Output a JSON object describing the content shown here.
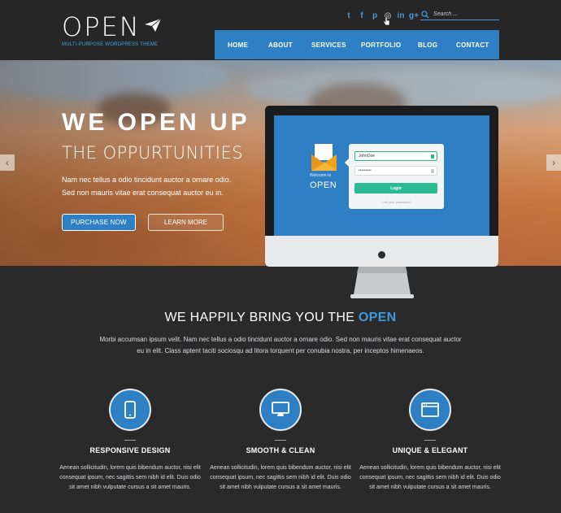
{
  "header": {
    "logo": "OPEN",
    "tagline": "MULTI-PURPOSE WORDPRESS THEME",
    "social": [
      {
        "icon": "twitter-icon",
        "glyph": "t"
      },
      {
        "icon": "facebook-icon",
        "glyph": "f"
      },
      {
        "icon": "pinterest-icon",
        "glyph": "p"
      },
      {
        "icon": "dribbble-icon",
        "glyph": "◎"
      },
      {
        "icon": "linkedin-icon",
        "glyph": "in"
      },
      {
        "icon": "google-plus-icon",
        "glyph": "g+"
      }
    ],
    "search_placeholder": "Search ...",
    "nav": [
      "HOME",
      "ABOUT",
      "SERVICES",
      "PORTFOLIO",
      "BLOG",
      "CONTACT"
    ]
  },
  "hero": {
    "title": "WE OPEN UP",
    "subtitle": "THE OPPURTUNITIES",
    "line1": "Nam nec tellus a odio tincidunt auctor a ornare odio.",
    "line2": "Sed non  mauris vitae erat consequat auctor eu in.",
    "purchase_label": "PURCHASE NOW",
    "learn_label": "LEARN MORE",
    "prev": "‹",
    "next": "›"
  },
  "screen": {
    "welcome": "Welcome to",
    "brand": "OPEN",
    "username": "JohnDoe",
    "password": "•••••••••",
    "login_label": "Login",
    "lost_password": "Lost your password?"
  },
  "intro": {
    "title_prefix": "WE HAPPILY BRING YOU THE",
    "title_highlight": "OPEN",
    "line1": "Morbi accumsan ipsum velit. Nam nec tellus a odio tincidunt auctor a ornare odio. Sed non  mauris vitae erat consequat auctor",
    "line2": "eu in elit. Class aptent taciti sociosqu ad litora torquent per conubia nostra, per inceptos himenaeos."
  },
  "features": [
    {
      "icon": "smartphone-icon",
      "title": "RESPONSIVE DESIGN",
      "lines": [
        "Aenean sollicitudin, lorem quis bibendum auctor, nisi elit",
        "consequat ipsum, nec sagittis sem nibh id elit. Duis odio",
        "sit amet nibh vulputate cursus a sit amet mauris."
      ]
    },
    {
      "icon": "monitor-icon",
      "title": "SMOOTH & CLEAN",
      "lines": [
        "Aenean sollicitudin, lorem quis bibendum auctor, nisi elit",
        "consequat ipsum, nec sagittis sem nibh id elit. Duis odio",
        "sit amet nibh vulputate cursus a sit amet mauris."
      ]
    },
    {
      "icon": "browser-window-icon",
      "title": "UNIQUE & ELEGANT",
      "lines": [
        "Aenean sollicitudin, lorem quis bibendum auctor, nisi elit",
        "consequat ipsum, nec sagittis sem nibh id elit. Duis odio",
        "sit amet nibh vulputate cursus a sit amet mauris."
      ]
    }
  ],
  "colors": {
    "accent": "#2e7fc3",
    "background": "#2a2a2b",
    "login_button": "#2bbb93"
  }
}
